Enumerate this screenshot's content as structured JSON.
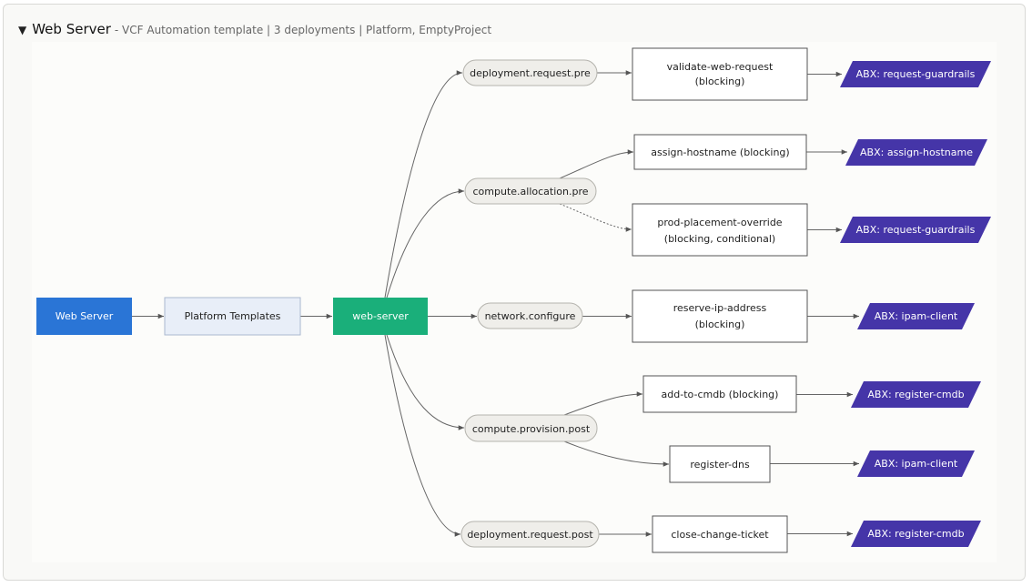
{
  "header": {
    "toggle": "▼",
    "title": "Web Server",
    "subtitle": "- VCF Automation template | 3 deployments | Platform, EmptyProject"
  },
  "colors": {
    "catalog": "#2a75d6",
    "template": "#e8eef8",
    "blueprint": "#1aaf7a",
    "topic_fill": "#efeeea",
    "abx": "#4535a8",
    "edge": "#666666"
  },
  "nodes": {
    "catalog": "Web Server",
    "template": "Platform Templates",
    "blueprint": "web-server",
    "topics": [
      "deployment.request.pre",
      "compute.allocation.pre",
      "network.configure",
      "compute.provision.post",
      "deployment.request.post"
    ],
    "subscriptions": [
      [
        "validate-web-request",
        "(blocking)"
      ],
      [
        "assign-hostname (blocking)"
      ],
      [
        "prod-placement-override",
        "(blocking, conditional)"
      ],
      [
        "reserve-ip-address",
        "(blocking)"
      ],
      [
        "add-to-cmdb (blocking)"
      ],
      [
        "register-dns"
      ],
      [
        "close-change-ticket"
      ]
    ],
    "actions": [
      "ABX: request-guardrails",
      "ABX: assign-hostname",
      "ABX: request-guardrails",
      "ABX: ipam-client",
      "ABX: register-cmdb",
      "ABX: ipam-client",
      "ABX: register-cmdb"
    ]
  }
}
